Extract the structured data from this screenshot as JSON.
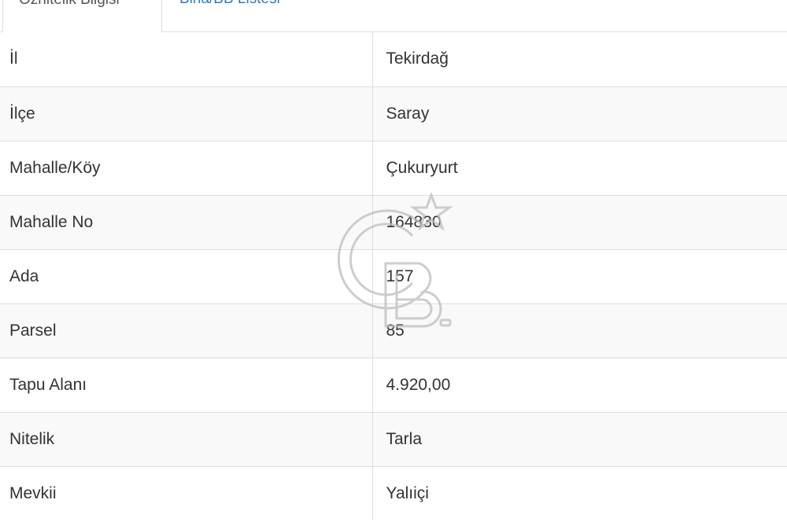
{
  "tabs": [
    {
      "label": "Öznitelik Bilgisi",
      "active": true
    },
    {
      "label": "Bina/BB Listesi",
      "active": false
    }
  ],
  "rows": [
    {
      "key": "İl",
      "value": "Tekirdağ"
    },
    {
      "key": "İlçe",
      "value": "Saray"
    },
    {
      "key": "Mahalle/Köy",
      "value": "Çukuryurt"
    },
    {
      "key": "Mahalle No",
      "value": "164830"
    },
    {
      "key": "Ada",
      "value": "157"
    },
    {
      "key": "Parsel",
      "value": "85"
    },
    {
      "key": "Tapu Alanı",
      "value": "4.920,00"
    },
    {
      "key": "Nitelik",
      "value": "Tarla"
    },
    {
      "key": "Mevkii",
      "value": "Yalıiçi"
    }
  ],
  "colors": {
    "link": "#337ab7",
    "border": "#dddddd",
    "stripe": "#f9f9f9",
    "text": "#333333"
  },
  "watermark": {
    "icon": "cb-logo-icon"
  }
}
